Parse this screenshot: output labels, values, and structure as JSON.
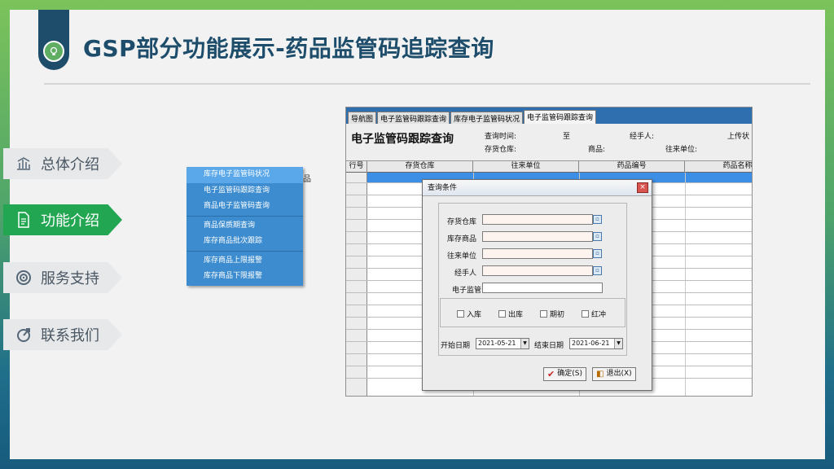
{
  "slide": {
    "title": "GSP部分功能展示-药品监管码追踪查询",
    "badge_icon": "lightbulb-icon"
  },
  "nav": [
    {
      "label": "总体介绍",
      "icon": "bar-chart-icon",
      "active": false
    },
    {
      "label": "功能介绍",
      "icon": "document-icon",
      "active": true
    },
    {
      "label": "服务支持",
      "icon": "target-icon",
      "active": false
    },
    {
      "label": "联系我们",
      "icon": "phone-icon",
      "active": false
    }
  ],
  "popup_menu": {
    "items": [
      "库存电子监管码状况",
      "电子监管码跟踪查询",
      "商品电子监管码查询",
      "商品保质期查询",
      "库存商品批次跟踪",
      "库存商品上限报警",
      "库存商品下限报警"
    ],
    "stray_text": "品"
  },
  "app": {
    "tabs": [
      "导航图",
      "电子监管码跟踪查询",
      "库存电子监管码状况",
      "电子监管码跟踪查询"
    ],
    "form_title": "电子监管码跟踪查询",
    "header_labels": {
      "query_time": "查询时间:",
      "to": "至",
      "handler": "经手人:",
      "upload_status": "上传状",
      "warehouse": "存货仓库:",
      "goods": "商品:",
      "partner": "往来单位:"
    },
    "columns": [
      "行号",
      "存货仓库",
      "往来单位",
      "药品编号",
      "药品名称"
    ],
    "dialog": {
      "title": "查询条件",
      "close": "×",
      "fields": [
        "存货仓库",
        "库存商品",
        "往来单位",
        "经手人",
        "电子监管"
      ],
      "checkboxes": [
        "入库",
        "出库",
        "期初",
        "红冲"
      ],
      "start_label": "开始日期",
      "start_date": "2021-05-21",
      "end_label": "结束日期",
      "end_date": "2021-06-21",
      "ok": "确定(S)",
      "exit": "退出(X)"
    }
  }
}
